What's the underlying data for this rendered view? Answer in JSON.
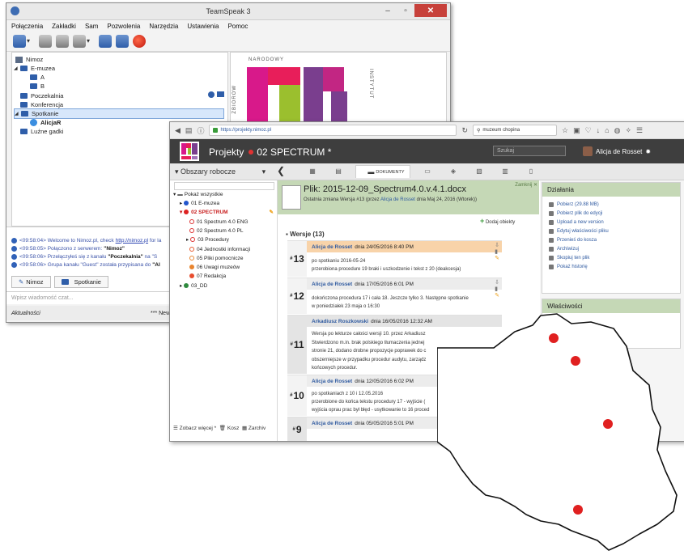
{
  "teamspeak": {
    "title": "TeamSpeak 3",
    "window_buttons": [
      "–",
      "▫",
      "✕"
    ],
    "menu": [
      "Połączenia",
      "Zakładki",
      "Sam",
      "Pozwolenia",
      "Narzędzia",
      "Ustawienia",
      "Pomoc"
    ],
    "tree": {
      "server": "Nimoz",
      "channels": [
        {
          "label": "E-muzea"
        },
        {
          "label": "A"
        },
        {
          "label": "B"
        },
        {
          "label": "Poczekalnia"
        },
        {
          "label": "Konferencja"
        },
        {
          "label": "Spotkanie"
        },
        {
          "label": "AlicjaR"
        },
        {
          "label": "Luźne gadki"
        }
      ]
    },
    "banner": {
      "word_top": "NARODOWY",
      "word_right": "INSTYTUT",
      "word_left": "ZBIORÓW"
    },
    "chat": [
      {
        "time": "<09:58:04>",
        "text": "Welcome to Nimoz.pl, check",
        "link": "http://nimoz.pl",
        "tail": "for la"
      },
      {
        "time": "<09:58:05>",
        "text": "Połączono z serwerem:",
        "bold": "\"Nimoz\""
      },
      {
        "time": "<09:58:06>",
        "text": "Przełączyłeś się z kanału",
        "bold": "\"Poczekalnia\"",
        "tail": "na \"S"
      },
      {
        "time": "<09:58:06>",
        "text": "Grupa kanału \"Guest\" została przypisana do",
        "bold": "\"Al"
      }
    ],
    "tabs": [
      "Nimoz",
      "Spotkanie"
    ],
    "message_placeholder": "Wpisz wiadomość czat...",
    "status_left": "Aktualności",
    "status_right": "*** New T"
  },
  "browser": {
    "url": "https://projekty.nimoz.pl",
    "search": "muzeum chopina",
    "header": {
      "projects": "Projekty",
      "space": "02 SPECTRUM *",
      "search_placeholder": "Szukaj",
      "user": "Alicja de Rosset"
    },
    "workspaces_label": "Obszary robocze",
    "active_tab": "DOKUMENTY",
    "tree": {
      "show_all": "Pokaż wszystkie",
      "items": [
        {
          "label": "01 E-muzea",
          "color": "#2255cc"
        },
        {
          "label": "02 SPECTRUM",
          "color": "#dd2222"
        },
        {
          "label": "01 Spectrum 4.0 ENG",
          "color": "#dd3333"
        },
        {
          "label": "02 Spectrum 4.0 PL",
          "color": "#dd3333"
        },
        {
          "label": "03 Procedury",
          "color": "#dd3333"
        },
        {
          "label": "04 Jednostki informacji",
          "color": "#e85a2e"
        },
        {
          "label": "05 Pliki pomocnicze",
          "color": "#e8842e"
        },
        {
          "label": "06 Uwagi muzeów",
          "color": "#e8842e"
        },
        {
          "label": "07 Redakcja",
          "color": "#e84d2e"
        },
        {
          "label": "03_DD",
          "color": "#2e8a3e"
        }
      ],
      "footer_more": "Zobacz więcej *",
      "footer_trash": "Kosz",
      "footer_archive": "Zarchiv"
    },
    "file": {
      "name": "Plik: 2015-12-09_Spectrum4.0.v.4.1.docx",
      "meta_prefix": "Ostatnia zmiana Wersja #13 (przez",
      "meta_author": "Alicja de Rosset",
      "meta_suffix": "dnia Maj 24, 2016 (Wtorek))",
      "zamknij": "Zamknij",
      "add_objects": "Dodaj obiekty"
    },
    "versions_title": "Wersje (13)",
    "versions": [
      {
        "num": "13",
        "author": "Alicja de Rosset",
        "date": "dnia 24/05/2016 8:40 PM",
        "lines": [
          "po spotkaniu 2016-05-24",
          "przerobiona procedure 19 braki i uszkodzenie i tekst z 20 (deakcesja)"
        ]
      },
      {
        "num": "12",
        "author": "Alicja de Rosset",
        "date": "dnia 17/05/2016 6:01 PM",
        "lines": [
          "dokończona procedura 17 i cała 18. Jeszcze tylko 3. Następne spotkanie",
          "w poniedziałek 23 maja o 16:30"
        ]
      },
      {
        "num": "11",
        "author": "Arkadiusz Roszkowski",
        "date": "dnia 16/05/2016 12:32 AM",
        "lines": [
          "Wersja po lekturze całości wersji 10. przez Arkadiusz",
          "Stwierdzono m.in. brak polskiego tłumaczenia jednej",
          "stronie 21, dodano drobne propozycje poprawek do c",
          "obszerniejsze w przypadku procedur audytu, zarządz",
          "końcowych procedur."
        ]
      },
      {
        "num": "10",
        "author": "Alicja de Rosset",
        "date": "dnia 12/05/2016 6:02 PM",
        "lines": [
          "po spotkaniach z 10 i 12.05.2016",
          "przerobione do końca tekstu procedury 17 - wyjście (",
          "wyjścia oprau prac był błęd - usytkowanie to 16 proced"
        ]
      },
      {
        "num": "9",
        "author": "Alicja de Rosset",
        "date": "dnia 05/05/2016 5:01 PM",
        "lines": []
      }
    ],
    "actions_title": "Działania",
    "actions": [
      "Pobierz (29.88 MB)",
      "Pobierz plik do edycji",
      "Upload a new version",
      "Edytuj właściwości pliku",
      "Przenieś do kosza",
      "Archiwizuj",
      "Skopiuj ten plik",
      "Pokaż historię"
    ],
    "properties_title": "Właściwości"
  },
  "map": {
    "country": "Poland",
    "point_color": "#e02020",
    "outline_color": "#111111"
  }
}
